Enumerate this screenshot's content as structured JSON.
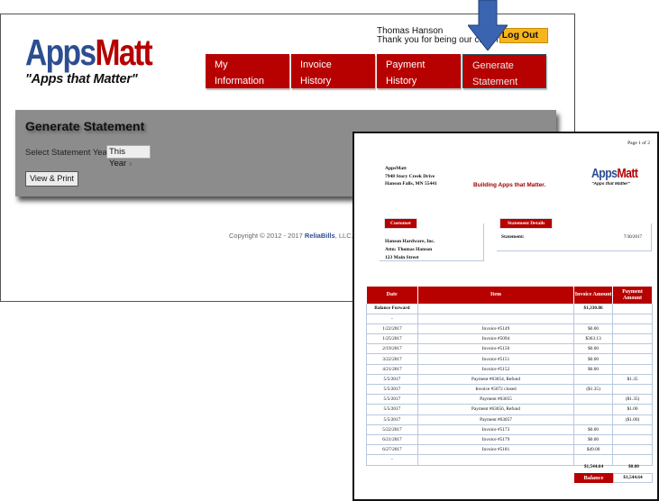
{
  "site": {
    "logo_apps": "Apps",
    "logo_matt": "Matt",
    "tagline": "\"Apps that Matter\"",
    "user_name": "Thomas Hanson",
    "welcome": "Thank you for being our customer.",
    "logout_label": "Log Out",
    "nav": [
      {
        "line1": "My",
        "line2": "Information"
      },
      {
        "line1": "Invoice",
        "line2": "History"
      },
      {
        "line1": "Payment",
        "line2": "History"
      },
      {
        "line1": "Generate",
        "line2": "Statement"
      }
    ],
    "panel_title": "Generate Statement",
    "year_label": "Select Statement Year",
    "year_value": "This Year",
    "view_button": "View & Print",
    "copyright_pre": "Copyright © 2012 - 2017 ",
    "copyright_brand": "ReliaBills",
    "copyright_post": ", LLC."
  },
  "statement": {
    "page": "Page 1 of 2",
    "company_lines": [
      "AppsMatt",
      "7948 Story Creek Drive",
      "Hanson Falls, MN 55441"
    ],
    "slogan": "Building Apps that Matter.",
    "logo_apps": "Apps",
    "logo_matt": "Matt",
    "logo_tag": "\"Apps that Matter\"",
    "customer_header": "Customer",
    "customer_lines": [
      "Hanson Hardware, Inc.",
      "Attn: Thomas Hanson",
      "123 Main Street"
    ],
    "details_header": "Statement Details",
    "statement_label": "Statement:",
    "statement_date": "7/30/2017",
    "columns": [
      "Date",
      "Item",
      "Invoice Amount",
      "Payment Amount"
    ],
    "rows": [
      {
        "date": "Balance Forward",
        "item": "",
        "invoice": "$1,330.86",
        "payment": "",
        "bold": true
      },
      {
        "date": "-",
        "item": "",
        "invoice": "",
        "payment": ""
      },
      {
        "date": "1/22/2017",
        "item": "Invoice #5149",
        "invoice": "$0.00",
        "payment": ""
      },
      {
        "date": "1/25/2017",
        "item": "Invoice #5094",
        "invoice": "$363.13",
        "payment": ""
      },
      {
        "date": "2/19/2017",
        "item": "Invoice #5150",
        "invoice": "$0.00",
        "payment": ""
      },
      {
        "date": "3/22/2017",
        "item": "Invoice #5151",
        "invoice": "$0.00",
        "payment": ""
      },
      {
        "date": "4/21/2017",
        "item": "Invoice #5152",
        "invoice": "$0.00",
        "payment": ""
      },
      {
        "date": "5/5/2017",
        "item": "Payment #63054, Refund",
        "invoice": "",
        "payment": "$1.35"
      },
      {
        "date": "5/5/2017",
        "item": "Invoice #5072 closed",
        "invoice": "($1.35)",
        "payment": ""
      },
      {
        "date": "5/5/2017",
        "item": "Payment #63055",
        "invoice": "",
        "payment": "($1.35)"
      },
      {
        "date": "5/5/2017",
        "item": "Payment #63056, Refund",
        "invoice": "",
        "payment": "$1.00"
      },
      {
        "date": "5/5/2017",
        "item": "Payment #63057",
        "invoice": "",
        "payment": "($1.00)"
      },
      {
        "date": "5/22/2017",
        "item": "Invoice #5173",
        "invoice": "$0.00",
        "payment": ""
      },
      {
        "date": "6/21/2017",
        "item": "Invoice #5179",
        "invoice": "$0.00",
        "payment": ""
      },
      {
        "date": "6/27/2017",
        "item": "Invoice #5181",
        "invoice": "$49.00",
        "payment": ""
      },
      {
        "date": "-",
        "item": "",
        "invoice": "",
        "payment": ""
      }
    ],
    "total_invoice": "$1,544.64",
    "total_payment": "$0.00",
    "balance_label": "Balance",
    "balance_value": "$1,544.64"
  },
  "colors": {
    "brand_red": "#b70000",
    "brand_blue": "#2d4d92",
    "logout_yellow": "#f7b51d",
    "panel_gray": "#8c8c8c",
    "arrow_blue": "#3a64b0"
  }
}
